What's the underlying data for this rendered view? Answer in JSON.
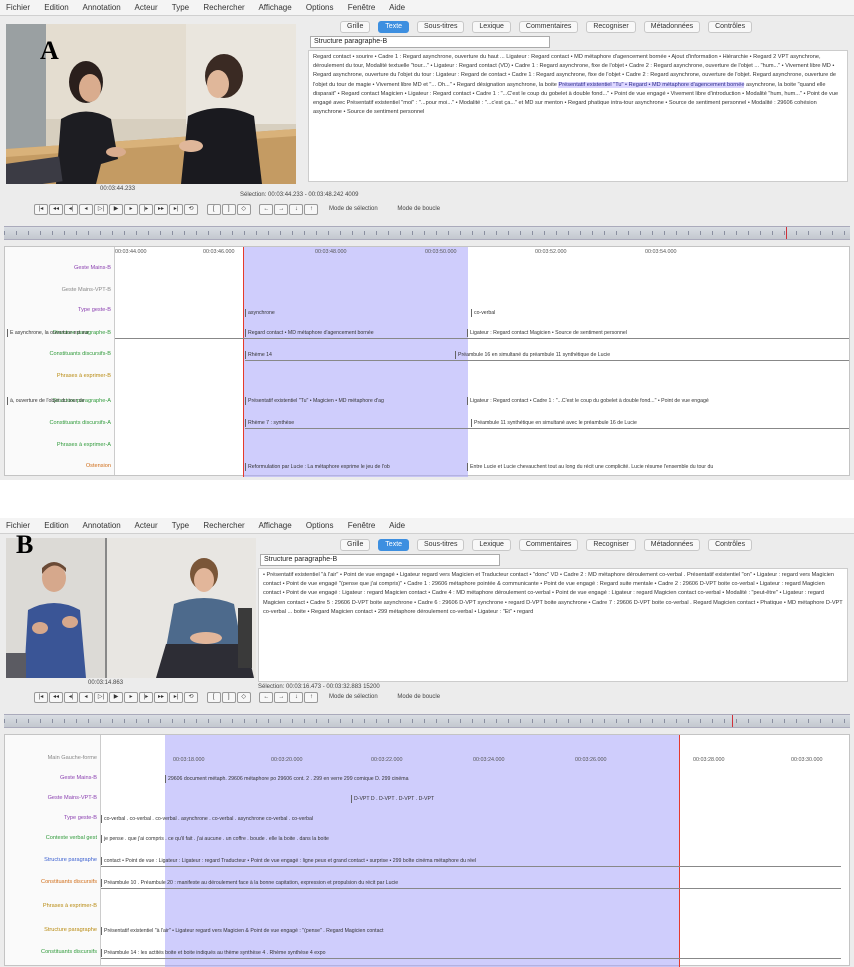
{
  "menu": [
    "Fichier",
    "Edition",
    "Annotation",
    "Acteur",
    "Type",
    "Rechercher",
    "Affichage",
    "Options",
    "Fenêtre",
    "Aide"
  ],
  "panelA": {
    "letter": "A",
    "tabs": [
      "Grille",
      "Texte",
      "Sous-titres",
      "Lexique",
      "Commentaires",
      "Recogniser",
      "Métadonnées",
      "Contrôles"
    ],
    "active_tab": "Texte",
    "tier": "Structure paragraphe-B",
    "text_before": "Regard contact • sourire • Cadre 1 : Regard asynchrone, ouverture du haut ... Ligateur : Regard contact • MD métaphore d'agencement bornée • Ajout d'information • Hiérarchie • Regard 2 VPT asynchrone, déroulement du tour, Modalité textuelle \"tour...\" • Ligateur : Regard contact (VD) • Cadre 1 : Regard asynchrone, fixe de l'objet • Cadre 2 : Regard asynchrone, ouverture de l'objet ... \"hum...\" • Vivement libre MD • Regard asynchrone, ouverture du l'objet du tour : Ligateur : Regard de contact • Cadre 1 : Regard asynchrone, fixe de l'objet • Cadre 2 : Regard asynchrone, ouverture de l'objet. Regard asynchrone, ouverture de l'objet du tour de magie • Vivement libre MD et \"... Oh...\" • Regard désignation asynchrone, la boite",
    "text_highlight": "Présentatif existentiel \"Tu\" • Regard • MD métaphore d'agencement bornée",
    "text_after": "asynchrone, la boite \"quand elle disparait\" • Regard contact Magicien • Ligateur : Regard contact • Cadre 1 : \"...C'est le coup du gobelet à double fond...\" • Point de vue engagé • Vivement libre d'introduction • Modalité \"hum, hum...\" • Point de vue engagé avec Présentatif existentiel \"moi\" : \"...pour moi...\" • Modalité : \"...c'est ça...\" et MD sur menton • Regard phatique intra-tour asynchrone • Source de sentiment personnel • Modalité : 29606 cohésion asynchrone • Source de sentiment personnel",
    "media_time": "00:03:44.233",
    "selection": "Sélection: 00:03:44.233 - 00:03:48.242  4009",
    "mode1": "Mode de sélection",
    "mode2": "Mode de boucle",
    "ticks": [
      "00:03:44.000",
      "00:03:46.000",
      "00:03:48.000",
      "00:03:50.000",
      "00:03:52.000",
      "00:03:54.000"
    ],
    "tiers": [
      "Geste Mains-B",
      "Geste Mains-VPT-B",
      "Type geste-B",
      "Structure paragraphe-B",
      "Constituants discursifs-B",
      "Phrases à exprimer-B",
      "Structure paragraphe-A",
      "Constituants discursifs-A",
      "Phrases à exprimer-A",
      "Ostension"
    ],
    "segments": [
      {
        "row": 3,
        "text": "asynchrone"
      },
      {
        "row": 3,
        "text": "co-verbal"
      },
      {
        "row": 4,
        "text": "E asynchrone, la ouverture est sur"
      },
      {
        "row": 4,
        "text": "Regard contact • MD métaphore d'agencement bornée"
      },
      {
        "row": 4,
        "text": "Ligateur : Regard contact Magicien • Source de sentiment personnel"
      },
      {
        "row": 5,
        "text": "Rhème 14"
      },
      {
        "row": 5,
        "text": "Préambule 16 en simultané du préambule 11 synthétique de Lucie"
      },
      {
        "row": 7,
        "text": "à, ouverture de l'objet du tour de"
      },
      {
        "row": 7,
        "text": "Présentatif existentiel \"Tu\" • Magicien • MD métaphore d'ag"
      },
      {
        "row": 7,
        "text": "Ligateur : Regard contact • Cadre 1 : \"...C'est le coup du gobelet à double fond...\" • Point de vue engagé"
      },
      {
        "row": 8,
        "text": "Rhème 7 : synthèse"
      },
      {
        "row": 8,
        "text": "Préambule 11 synthétique en simultané avec le préambule 16 de Lucie"
      },
      {
        "row": 10,
        "text": "Reformulation par Lucie : La métaphore exprime le jeu de l'ob"
      },
      {
        "row": 10,
        "text": "Entre Lucie et Lucie chevauchent tout au long du récit une complicité. Lucie résume l'ensemble du tour du"
      }
    ]
  },
  "panelB": {
    "letter": "B",
    "tabs": [
      "Grille",
      "Texte",
      "Sous-titres",
      "Lexique",
      "Commentaires",
      "Recogniser",
      "Métadonnées",
      "Contrôles"
    ],
    "active_tab": "Texte",
    "tier": "Structure paragraphe-B",
    "text_before": "• Présentatif existentiel \"à l'air\" • Point de vue engagé • Ligateur regard vers Magicien et Traducteur contact • \"donc\" VD • Cadre 2 : MD métaphore déroulement co-verbal . Présentatif existentiel \"on\" • Ligateur : regard vers Magicien contact • Point de vue engagé \"(pense que j'ai compris)\" • Cadre 1 : 29606 métaphore pointée & communicante • Point de vue engagé : Regard suite mentale • Cadre 2 : 29606 D-VPT boite co-verbal • Ligateur : regard Magicien contact • Point de vue engagé : Ligateur : regard Magicien contact • Cadre 4 : MD métaphore déroulement co-verbal • Point de vue engagé : Ligateur : regard Magicien contact co-verbal • Modalité : \"peut-être\" • Ligateur : regard Magicien contact • Cadre 5 : 29606 D-VPT boite asynchrone • Cadre 6 : 29606 D-VPT synchrone • regard D-VPT boite asynchrone • Cadre 7 : 29606 D-VPT boite co-verbal . Regard Magicien contact • Phatique • MD métaphore D-VPT co-verbal ... boite • Regard Magicien contact • 299 métaphore déroulement co-verbal",
    "text_highlight": "",
    "text_after": "• Ligateur : \"Et\" • regard",
    "media_time": "00:03:14.863",
    "selection": "Sélection: 00:03:16.473 - 00:03:32.883  15200",
    "mode1": "Mode de sélection",
    "mode2": "Mode de boucle",
    "ticks": [
      "00:03:18.000",
      "00:03:20.000",
      "00:03:22.000",
      "00:03:24.000",
      "00:03:26.000",
      "00:03:28.000",
      "00:03:30.000"
    ],
    "tiers": [
      "Main Gauche-forme",
      "Geste Mains-B",
      "Geste Mains-VPT-B",
      "Type geste-B",
      "Contexte verbal gest",
      "Structure paragraphe",
      "Constituants discursifs",
      "Phrases à exprimer-B",
      "Structure paragraphe",
      "Constituants discursifs"
    ],
    "segments": [
      {
        "row": 1,
        "text": "29606 document métaph. 29606 métaphore po 29606 cont. 2 . 299 en verre 299 comique D. 299 cinéma"
      },
      {
        "row": 2,
        "text": "D-VPT  D  . D-VPT . D-VPT . D-VPT"
      },
      {
        "row": 3,
        "text": "co-verbal . co-verbal . co-verbal . asynchrone . co-verbal . asynchrone co-verbal . co-verbal"
      },
      {
        "row": 4,
        "text": "je pense . que j'ai compris . ce qu'il fait . j'ai aucune . un coffre . boude . elle la boite . dans la boite"
      },
      {
        "row": 5,
        "text": "contact • Point de vue : Ligateur : Ligateur : regard Traducteur • Point de vue engagé : ligne peux et grand contact • surprise • 299 boîte cinéma métaphore du réel"
      },
      {
        "row": 6,
        "text": "Préambule 10 . Préambule 20 : manifeste au déroulement face à la bonne capitation, expression et propulsion du récit par Lucie"
      },
      {
        "row": 8,
        "text": "Présentatif existentiel \"à l'air\" • Ligateur regard vers Magicien & Point de vue engagé : \"(pense\" . Regard Magicien contact"
      },
      {
        "row": 9,
        "text": "Préambule 14 : les actités boite et boite indiqués au thème synthèse 4 . Rhème synthèse 4 expo"
      }
    ]
  }
}
